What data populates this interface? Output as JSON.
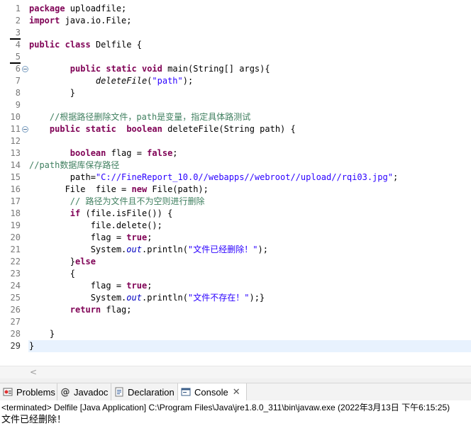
{
  "editor": {
    "line_numbers": [
      "1",
      "2",
      "3",
      "4",
      "5",
      "6",
      "7",
      "8",
      "9",
      "10",
      "11",
      "12",
      "13",
      "14",
      "15",
      "16",
      "17",
      "18",
      "19",
      "20",
      "21",
      "22",
      "23",
      "24",
      "25",
      "26",
      "27",
      "28",
      "29"
    ],
    "current_line": "29",
    "lines": [
      [
        {
          "t": "package",
          "c": "kw"
        },
        {
          "t": " uploadfile;"
        }
      ],
      [
        {
          "t": "import",
          "c": "kw"
        },
        {
          "t": " java.io.File;"
        }
      ],
      [],
      [
        {
          "t": "public",
          "c": "kw"
        },
        {
          "t": " "
        },
        {
          "t": "class",
          "c": "kw"
        },
        {
          "t": " Delfile {"
        }
      ],
      [],
      [
        {
          "t": "        "
        },
        {
          "t": "public",
          "c": "kw"
        },
        {
          "t": " "
        },
        {
          "t": "static",
          "c": "kw"
        },
        {
          "t": " "
        },
        {
          "t": "void",
          "c": "kw"
        },
        {
          "t": " main(String[] args){"
        }
      ],
      [
        {
          "t": "             "
        },
        {
          "t": "deleteFile",
          "c": "mi"
        },
        {
          "t": "("
        },
        {
          "t": "\"path\"",
          "c": "str"
        },
        {
          "t": ");"
        }
      ],
      [
        {
          "t": "        }"
        }
      ],
      [],
      [
        {
          "t": "    //",
          "c": "cm"
        },
        {
          "t": "根据路径删除文件，",
          "c": "cm cjk"
        },
        {
          "t": "path",
          "c": "cm"
        },
        {
          "t": "是变量，指定具体路测试",
          "c": "cm cjk"
        }
      ],
      [
        {
          "t": "    "
        },
        {
          "t": "public",
          "c": "kw"
        },
        {
          "t": " "
        },
        {
          "t": "static",
          "c": "kw"
        },
        {
          "t": "  "
        },
        {
          "t": "boolean",
          "c": "kw"
        },
        {
          "t": " deleteFile(String path) {"
        }
      ],
      [],
      [
        {
          "t": "        "
        },
        {
          "t": "boolean",
          "c": "kw"
        },
        {
          "t": " flag = "
        },
        {
          "t": "false",
          "c": "kw"
        },
        {
          "t": ";"
        }
      ],
      [
        {
          "t": "//path",
          "c": "cm"
        },
        {
          "t": "数据库保存路径",
          "c": "cm cjk"
        }
      ],
      [
        {
          "t": "        path="
        },
        {
          "t": "\"C://FineReport_10.0//webapps//webroot//upload//rqi03.jpg\"",
          "c": "str"
        },
        {
          "t": ";"
        }
      ],
      [
        {
          "t": "       File  file = "
        },
        {
          "t": "new",
          "c": "kw"
        },
        {
          "t": " File(path);"
        }
      ],
      [
        {
          "t": "        // ",
          "c": "cm"
        },
        {
          "t": "路径为文件且不为空则进行删除",
          "c": "cm cjk"
        }
      ],
      [
        {
          "t": "        "
        },
        {
          "t": "if",
          "c": "kw"
        },
        {
          "t": " (file.isFile()) {"
        }
      ],
      [
        {
          "t": "            file.delete();"
        }
      ],
      [
        {
          "t": "            flag = "
        },
        {
          "t": "true",
          "c": "kw"
        },
        {
          "t": ";"
        }
      ],
      [
        {
          "t": "            System."
        },
        {
          "t": "out",
          "c": "fld"
        },
        {
          "t": ".println("
        },
        {
          "t": "\"",
          "c": "str"
        },
        {
          "t": "文件已经删除！",
          "c": "str cjk"
        },
        {
          "t": "\"",
          "c": "str"
        },
        {
          "t": ");"
        }
      ],
      [
        {
          "t": "        }"
        },
        {
          "t": "else",
          "c": "kw"
        }
      ],
      [
        {
          "t": "        {"
        }
      ],
      [
        {
          "t": "            flag = "
        },
        {
          "t": "true",
          "c": "kw"
        },
        {
          "t": ";"
        }
      ],
      [
        {
          "t": "            System."
        },
        {
          "t": "out",
          "c": "fld"
        },
        {
          "t": ".println("
        },
        {
          "t": "\"",
          "c": "str"
        },
        {
          "t": "文件不存在！",
          "c": "str cjk"
        },
        {
          "t": "\"",
          "c": "str"
        },
        {
          "t": ");}"
        }
      ],
      [
        {
          "t": "        "
        },
        {
          "t": "return",
          "c": "kw"
        },
        {
          "t": " flag;"
        }
      ],
      [],
      [
        {
          "t": "    }"
        }
      ],
      [
        {
          "t": "}"
        }
      ]
    ],
    "scroll_left_arrow": "<"
  },
  "tabs": [
    {
      "label": "Problems",
      "icon": "problems-icon",
      "active": false
    },
    {
      "label": "Javadoc",
      "icon": "javadoc-at-icon",
      "active": false
    },
    {
      "label": "Declaration",
      "icon": "declaration-icon",
      "active": false
    },
    {
      "label": "Console",
      "icon": "console-icon",
      "active": true
    }
  ],
  "console": {
    "terminated_line": "<terminated> Delfile [Java Application] C:\\Program Files\\Java\\jre1.8.0_311\\bin\\javaw.exe (2022年3月13日 下午6:15:25)",
    "output": "文件已经删除！"
  },
  "colors": {
    "keyword": "#7f0055",
    "comment": "#3f7f5f",
    "string": "#2a00ff",
    "field": "#0000c0",
    "current_line_bg": "#e8f2fe"
  }
}
